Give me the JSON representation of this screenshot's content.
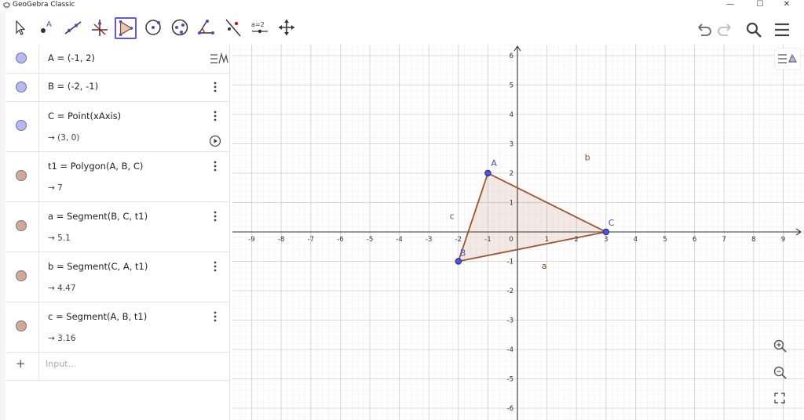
{
  "window": {
    "title": "GeoGebra Classic",
    "minimize_icon": "minimize-icon",
    "maximize_icon": "maximize-icon",
    "close_icon": "close-icon"
  },
  "toolbar": {
    "tools": [
      {
        "name": "move-tool-icon"
      },
      {
        "name": "point-tool-icon",
        "label": "A"
      },
      {
        "name": "line-tool-icon"
      },
      {
        "name": "perpendicular-tool-icon"
      },
      {
        "name": "polygon-tool-icon"
      },
      {
        "name": "circle-tool-icon"
      },
      {
        "name": "ellipse-tool-icon"
      },
      {
        "name": "angle-tool-icon"
      },
      {
        "name": "reflect-tool-icon"
      },
      {
        "name": "slider-tool-icon",
        "label": "a=2"
      },
      {
        "name": "move-graphics-tool-icon"
      }
    ],
    "right": [
      "undo-icon",
      "redo-icon",
      "search-icon",
      "menu-icon"
    ]
  },
  "algebra": {
    "rows": [
      {
        "def": "A = (-1, 2)",
        "color": "#b3b8ff"
      },
      {
        "def": "B = (-2, -1)",
        "color": "#b3b8ff"
      },
      {
        "def": "C = Point(xAxis)",
        "val": "→ (3, 0)",
        "color": "#b3b8ff"
      },
      {
        "def": "t1 = Polygon(A, B, C)",
        "val": "→ 7",
        "color": "#d4a892"
      },
      {
        "def": "a = Segment(B, C, t1)",
        "val": "→ 5.1",
        "color": "#d4a892"
      },
      {
        "def": "b = Segment(C, A, t1)",
        "val": "→ 4.47",
        "color": "#d4a892"
      },
      {
        "def": "c = Segment(A, B, t1)",
        "val": "→ 3.16",
        "color": "#d4a892"
      }
    ],
    "input_placeholder": "Input..."
  },
  "graphics": {
    "x_ticks": [
      "-9",
      "-8",
      "-7",
      "-6",
      "-5",
      "-4",
      "-3",
      "-2",
      "-1",
      "0",
      "1",
      "2",
      "3",
      "4",
      "5",
      "6",
      "7",
      "8",
      "9"
    ],
    "y_ticks": [
      "6",
      "5",
      "4",
      "3",
      "2",
      "1",
      "-1",
      "-2",
      "-3",
      "-4",
      "-5",
      "-6"
    ],
    "points": [
      {
        "label": "A",
        "x": -1,
        "y": 2
      },
      {
        "label": "B",
        "x": -2,
        "y": -1
      },
      {
        "label": "C",
        "x": 3,
        "y": 0
      }
    ],
    "segments": [
      {
        "label": "a",
        "from": "B",
        "to": "C"
      },
      {
        "label": "b",
        "from": "C",
        "to": "A"
      },
      {
        "label": "c",
        "from": "A",
        "to": "B"
      }
    ],
    "polygon_color": "#a0522d",
    "point_color": "#4d4dff"
  }
}
